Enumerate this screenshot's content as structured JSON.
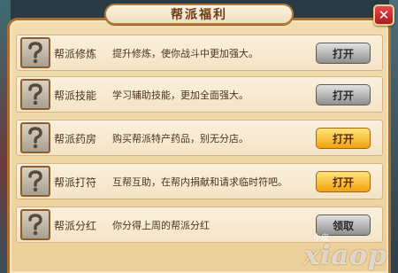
{
  "dialog": {
    "title": "帮派福利",
    "close_label": "✕"
  },
  "rows": [
    {
      "name": "帮派修炼",
      "description": "提升修炼，使你战斗中更加强大。",
      "button": "打开",
      "button_style": "gray"
    },
    {
      "name": "帮派技能",
      "description": "学习辅助技能，更加全面强大。",
      "button": "打开",
      "button_style": "gray"
    },
    {
      "name": "帮派药房",
      "description": "购买帮派特产药品，别无分店。",
      "button": "打开",
      "button_style": "gold"
    },
    {
      "name": "帮派打符",
      "description": "互帮互助，在帮内捐献和请求临时符吧。",
      "button": "打开",
      "button_style": "gold"
    },
    {
      "name": "帮派分红",
      "description": "你分得上周的帮派分红",
      "button": "领取",
      "button_style": "gray"
    }
  ],
  "icon": {
    "semantic": "question-mark-icon"
  },
  "watermark": {
    "text": "xiaop",
    "sub": "小皮"
  },
  "colors": {
    "panel": "#f2ddb0",
    "frame": "#a9702f",
    "gold_button": "#f0a310",
    "gray_button": "#8f8f8f",
    "close_button": "#a81b1f"
  }
}
